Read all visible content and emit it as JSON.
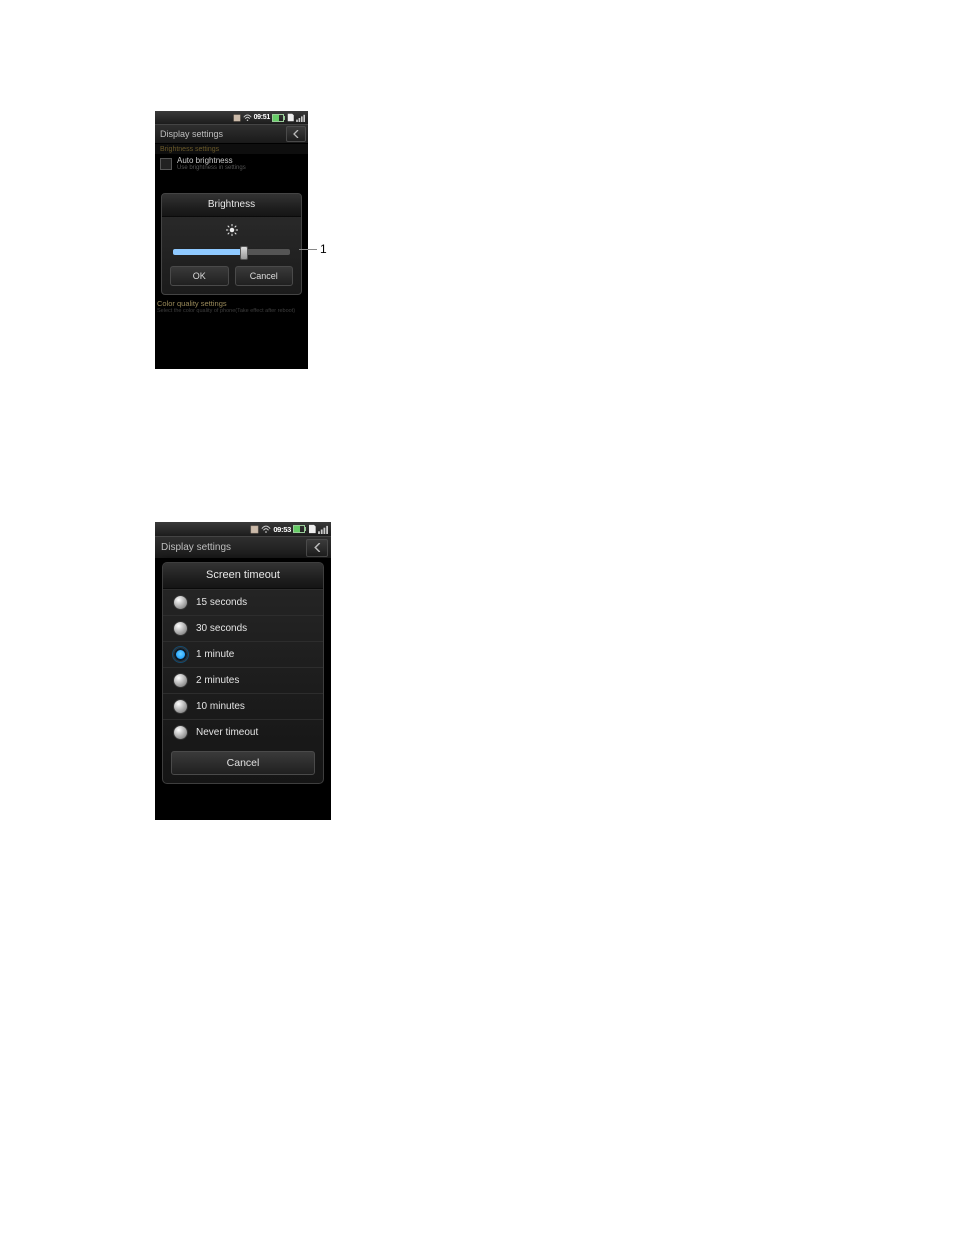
{
  "screen1": {
    "statusbar_time": "09:51",
    "title": "Display settings",
    "section_header": "Brightness settings",
    "auto_brightness_label": "Auto brightness",
    "auto_brightness_sub": "Use brightness in settings",
    "dialog_title": "Brightness",
    "ok_label": "OK",
    "cancel_label": "Cancel",
    "color_quality_hdr": "Color quality settings",
    "color_quality_sub": "Select the color quality of phone(Take effect after reboot)",
    "annotation": "1"
  },
  "screen2": {
    "statusbar_time": "09:53",
    "title": "Display settings",
    "dialog_title": "Screen timeout",
    "options": [
      "15 seconds",
      "30 seconds",
      "1 minute",
      "2 minutes",
      "10 minutes",
      "Never timeout"
    ],
    "selected_index": 2,
    "cancel_label": "Cancel"
  }
}
